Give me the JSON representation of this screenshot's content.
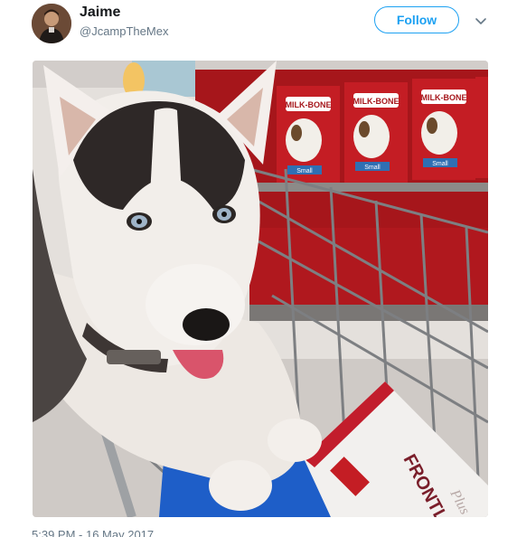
{
  "tweet": {
    "author_name": "Jaime",
    "author_handle": "@JcampTheMex",
    "follow_label": "Follow",
    "timestamp": "5:39 PM - 16 May 2017"
  },
  "media": {
    "box_brand": "MILK-BONE",
    "box_size": "Small",
    "package_brand": "FRONTLINE",
    "package_sub": "Plus"
  },
  "colors": {
    "accent": "#1da1f2",
    "secondary_text": "#657786"
  },
  "icons": {
    "menu": "chevron-down-icon"
  }
}
